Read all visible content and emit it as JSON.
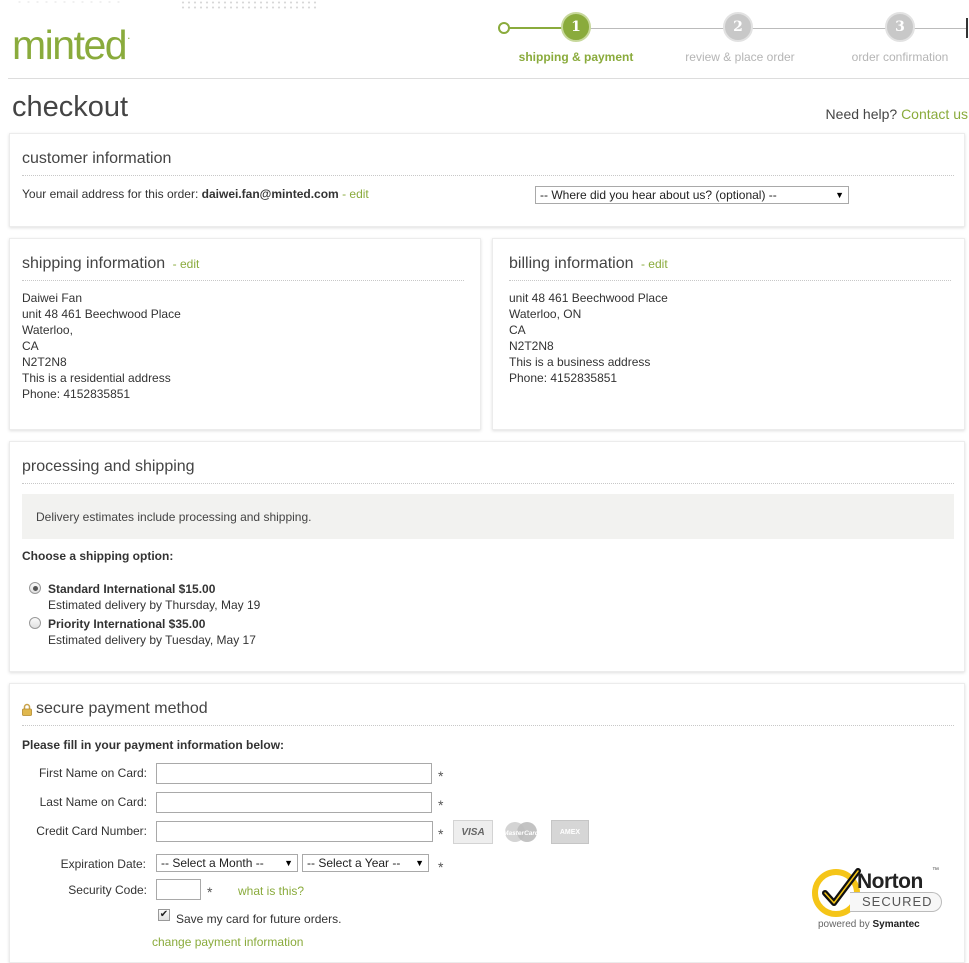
{
  "brand": {
    "logo_text": "minted",
    "logo_dot": "."
  },
  "progress": {
    "steps": [
      {
        "number": "1",
        "label": "shipping & payment",
        "state": "active"
      },
      {
        "number": "2",
        "label": "review & place order",
        "state": "inactive"
      },
      {
        "number": "3",
        "label": "order confirmation",
        "state": "inactive"
      }
    ]
  },
  "page": {
    "title": "checkout",
    "help_prefix": "Need help?",
    "help_link": "Contact us"
  },
  "customer": {
    "title": "customer information",
    "email_prefix": "Your email address for this order:",
    "email": "daiwei.fan@minted.com",
    "edit_label": "- edit",
    "hear_select": "-- Where did you hear about us? (optional) --"
  },
  "shipping": {
    "title": "shipping information",
    "edit_label": "- edit",
    "lines": [
      "Daiwei Fan",
      "unit 48 461 Beechwood Place",
      "Waterloo,",
      "CA",
      "N2T2N8",
      "This is a residential address",
      "Phone: 4152835851"
    ]
  },
  "billing": {
    "title": "billing information",
    "edit_label": "- edit",
    "lines": [
      "unit 48 461 Beechwood Place",
      "Waterloo, ON",
      "CA",
      "N2T2N8",
      "This is a business address",
      "Phone: 4152835851"
    ]
  },
  "processing": {
    "title": "processing and shipping",
    "notice": "Delivery estimates include processing and shipping.",
    "choose_label": "Choose a shipping option:",
    "options": [
      {
        "name": "Standard International $15.00",
        "estimate": "Estimated delivery by Thursday, May 19",
        "selected": true
      },
      {
        "name": "Priority International $35.00",
        "estimate": "Estimated delivery by Tuesday, May 17",
        "selected": false
      }
    ]
  },
  "payment": {
    "title": "secure payment method",
    "instructions": "Please fill in your payment information below:",
    "first_name_label": "First Name on Card:",
    "first_name_value": "",
    "last_name_label": "Last Name on Card:",
    "last_name_value": "",
    "card_number_label": "Credit Card Number:",
    "card_number_value": "",
    "expiration_label": "Expiration Date:",
    "month_select": "-- Select a Month --",
    "year_select": "-- Select a Year --",
    "security_label": "Security Code:",
    "security_value": "",
    "what_is_this": "what is this?",
    "save_card_label": "Save my card for future orders.",
    "save_card_checked": true,
    "change_link": "change payment information",
    "required_mark": "*",
    "card_brands": [
      "VISA",
      "MasterCard",
      "AMEX"
    ]
  },
  "norton": {
    "name": "Norton",
    "secured": "SECURED",
    "tm": "™",
    "powered_prefix": "powered by",
    "powered_brand": "Symantec"
  },
  "colors": {
    "accent": "#8aab3c",
    "text": "#333333",
    "muted": "#b5b5b5",
    "norton_yellow": "#f5c518"
  }
}
